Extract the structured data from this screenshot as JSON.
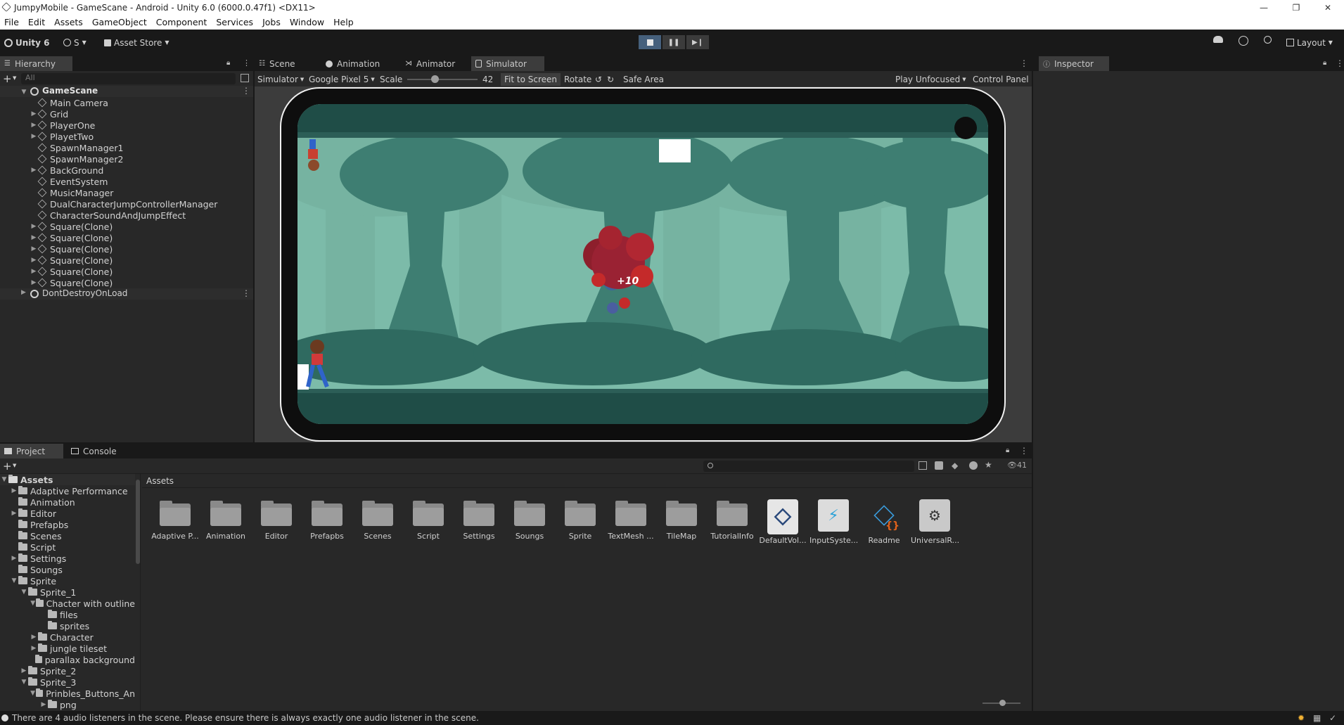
{
  "window": {
    "title": "JumpyMobile - GameScane - Android - Unity 6.0 (6000.0.47f1) <DX11>",
    "minimize": "—",
    "maximize": "❐",
    "close": "✕"
  },
  "menu": [
    "File",
    "Edit",
    "Assets",
    "GameObject",
    "Component",
    "Services",
    "Jobs",
    "Window",
    "Help"
  ],
  "toolbar": {
    "unity_label": "Unity 6",
    "account_label": "S",
    "asset_store_label": "Asset Store",
    "layout_label": "Layout",
    "play_active": true
  },
  "hierarchy": {
    "tab": "Hierarchy",
    "search_placeholder": "All",
    "scene": "GameScane",
    "items": [
      {
        "label": "Main Camera",
        "expandable": false
      },
      {
        "label": "Grid",
        "expandable": true
      },
      {
        "label": "PlayerOne",
        "expandable": true
      },
      {
        "label": "PlayetTwo",
        "expandable": true
      },
      {
        "label": "SpawnManager1",
        "expandable": false
      },
      {
        "label": "SpawnManager2",
        "expandable": false
      },
      {
        "label": "BackGround",
        "expandable": true
      },
      {
        "label": "EventSystem",
        "expandable": false
      },
      {
        "label": "MusicManager",
        "expandable": false
      },
      {
        "label": "DualCharacterJumpControllerManager",
        "expandable": false
      },
      {
        "label": "CharacterSoundAndJumpEffect",
        "expandable": false
      },
      {
        "label": "Square(Clone)",
        "expandable": true
      },
      {
        "label": "Square(Clone)",
        "expandable": true
      },
      {
        "label": "Square(Clone)",
        "expandable": true
      },
      {
        "label": "Square(Clone)",
        "expandable": true
      },
      {
        "label": "Square(Clone)",
        "expandable": true
      },
      {
        "label": "Square(Clone)",
        "expandable": true
      }
    ],
    "dont_destroy": "DontDestroyOnLoad"
  },
  "center_tabs": [
    "Scene",
    "Animation",
    "Animator",
    "Simulator"
  ],
  "simulator": {
    "mode": "Simulator",
    "device": "Google Pixel 5",
    "scale_label": "Scale",
    "scale_value": "42",
    "scale_fraction": 0.4,
    "fit_label": "Fit to Screen",
    "rotate_label": "Rotate",
    "safe_area_label": "Safe Area",
    "play_focus": "Play Unfocused",
    "control_panel": "Control Panel",
    "score_popup": "+10"
  },
  "inspector": {
    "tab": "Inspector"
  },
  "bottom_tabs": [
    "Project",
    "Console"
  ],
  "project": {
    "breadcrumb": "Assets",
    "count_label": "41",
    "tree": [
      {
        "label": "Assets",
        "depth": 0,
        "arrow": "▼",
        "folder": false,
        "bold": true
      },
      {
        "label": "Adaptive Performance",
        "depth": 1,
        "arrow": "▶",
        "folder": true
      },
      {
        "label": "Animation",
        "depth": 1,
        "arrow": "",
        "folder": true
      },
      {
        "label": "Editor",
        "depth": 1,
        "arrow": "▶",
        "folder": true
      },
      {
        "label": "Prefapbs",
        "depth": 1,
        "arrow": "",
        "folder": true
      },
      {
        "label": "Scenes",
        "depth": 1,
        "arrow": "",
        "folder": true
      },
      {
        "label": "Script",
        "depth": 1,
        "arrow": "",
        "folder": true
      },
      {
        "label": "Settings",
        "depth": 1,
        "arrow": "▶",
        "folder": true
      },
      {
        "label": "Soungs",
        "depth": 1,
        "arrow": "",
        "folder": true
      },
      {
        "label": "Sprite",
        "depth": 1,
        "arrow": "▼",
        "folder": true
      },
      {
        "label": "Sprite_1",
        "depth": 2,
        "arrow": "▼",
        "folder": true
      },
      {
        "label": "Chacter with outline",
        "depth": 3,
        "arrow": "▼",
        "folder": true
      },
      {
        "label": "files",
        "depth": 4,
        "arrow": "",
        "folder": true
      },
      {
        "label": "sprites",
        "depth": 4,
        "arrow": "",
        "folder": true
      },
      {
        "label": "Character",
        "depth": 3,
        "arrow": "▶",
        "folder": true
      },
      {
        "label": "jungle tileset",
        "depth": 3,
        "arrow": "▶",
        "folder": true
      },
      {
        "label": "parallax background",
        "depth": 3,
        "arrow": "",
        "folder": true
      },
      {
        "label": "Sprite_2",
        "depth": 2,
        "arrow": "▶",
        "folder": true
      },
      {
        "label": "Sprite_3",
        "depth": 2,
        "arrow": "▼",
        "folder": true
      },
      {
        "label": "Prinbles_Buttons_An",
        "depth": 3,
        "arrow": "▼",
        "folder": true
      },
      {
        "label": "png",
        "depth": 4,
        "arrow": "▶",
        "folder": true
      }
    ],
    "assets": [
      {
        "label": "Adaptive P...",
        "kind": "folder"
      },
      {
        "label": "Animation",
        "kind": "folder"
      },
      {
        "label": "Editor",
        "kind": "folder"
      },
      {
        "label": "Prefapbs",
        "kind": "folder"
      },
      {
        "label": "Scenes",
        "kind": "folder"
      },
      {
        "label": "Script",
        "kind": "folder"
      },
      {
        "label": "Settings",
        "kind": "folder"
      },
      {
        "label": "Soungs",
        "kind": "folder"
      },
      {
        "label": "Sprite",
        "kind": "folder"
      },
      {
        "label": "TextMesh ...",
        "kind": "folder"
      },
      {
        "label": "TileMap",
        "kind": "folder"
      },
      {
        "label": "TutorialInfo",
        "kind": "folder"
      },
      {
        "label": "DefaultVol...",
        "kind": "volume"
      },
      {
        "label": "InputSyste...",
        "kind": "input"
      },
      {
        "label": "Readme",
        "kind": "readme"
      },
      {
        "label": "UniversalR...",
        "kind": "pipeline"
      }
    ]
  },
  "status": "There are 4 audio listeners in the scene. Please ensure there is always exactly one audio listener in the scene."
}
